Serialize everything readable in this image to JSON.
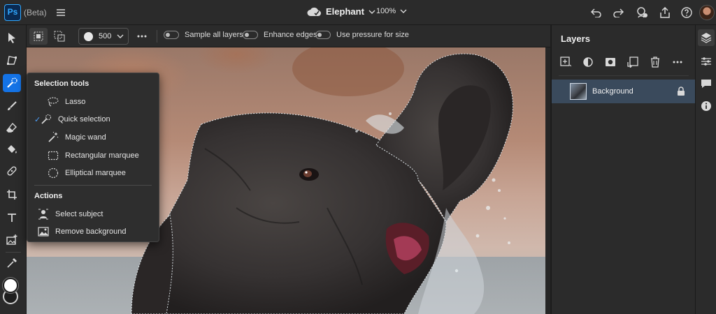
{
  "app": {
    "logo": "Ps",
    "beta_label": "(Beta)"
  },
  "header": {
    "document_name": "Elephant",
    "zoom": "100%",
    "icons": [
      "menu-icon",
      "cloud-icon",
      "undo-icon",
      "redo-icon",
      "invite-icon",
      "share-icon",
      "help-icon"
    ]
  },
  "options_bar": {
    "brush_size": "500",
    "sample_all_layers": {
      "label": "Sample all layers",
      "on": false
    },
    "enhance_edges": {
      "label": "Enhance edges",
      "on": false
    },
    "use_pressure": {
      "label": "Use pressure for size",
      "on": false
    }
  },
  "toolbar": {
    "tools": [
      "move",
      "transform",
      "quick-selection",
      "brush",
      "eraser",
      "paint-bucket",
      "healing",
      "crop",
      "type",
      "add-image",
      "eyedropper"
    ],
    "active_tool": "quick-selection",
    "foreground_color": "#ffffff",
    "background_color": "#1e1e1e"
  },
  "flyout": {
    "selection_header": "Selection tools",
    "items": [
      {
        "label": "Lasso",
        "checked": false
      },
      {
        "label": "Quick selection",
        "checked": true
      },
      {
        "label": "Magic wand",
        "checked": false
      },
      {
        "label": "Rectangular marquee",
        "checked": false
      },
      {
        "label": "Elliptical marquee",
        "checked": false
      }
    ],
    "actions_header": "Actions",
    "actions": [
      {
        "label": "Select subject"
      },
      {
        "label": "Remove background"
      }
    ]
  },
  "layers_panel": {
    "title": "Layers",
    "layers": [
      {
        "name": "Background",
        "locked": true,
        "selected": true
      }
    ]
  },
  "colors": {
    "accent": "#1473e6",
    "panel": "#2b2b2b",
    "selected_layer": "#3a4a5c"
  }
}
